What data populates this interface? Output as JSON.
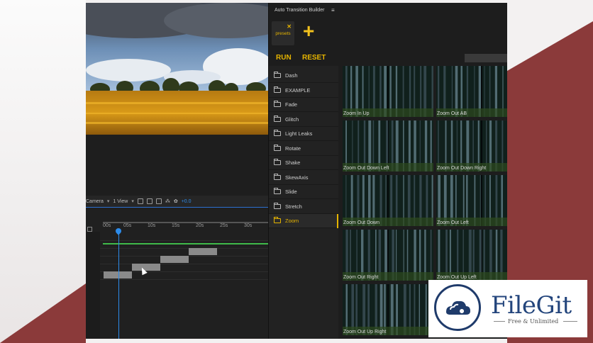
{
  "colors": {
    "accent": "#e6b400",
    "timeline_blue": "#2d8ceb",
    "layer_green": "#3fba4a",
    "brand_bg": "#8b3a3a",
    "logo_blue": "#23457c"
  },
  "viewer_toolbar": {
    "camera_label": "Camera",
    "view_label": "1 View",
    "exposure_value": "+0.0"
  },
  "timeline": {
    "ruler_labels": [
      "00s",
      "05s",
      "10s",
      "15s",
      "20s",
      "25s",
      "30s"
    ]
  },
  "panel": {
    "title": "Auto Transition Builder",
    "menu_icon": "hamburger-icon",
    "presets_tab_label": "presets",
    "add_icon": "plus-icon",
    "run_label": "RUN",
    "reset_label": "RESET",
    "folders": [
      {
        "label": "Dash"
      },
      {
        "label": "EXAMPLE"
      },
      {
        "label": "Fade"
      },
      {
        "label": "Glitch"
      },
      {
        "label": "Light Leaks"
      },
      {
        "label": "Rotate"
      },
      {
        "label": "Shake"
      },
      {
        "label": "SkewAxis"
      },
      {
        "label": "Slide"
      },
      {
        "label": "Stretch"
      },
      {
        "label": "Zoom"
      }
    ],
    "active_folder": "Zoom",
    "presets": [
      {
        "label": "Zoom In Up"
      },
      {
        "label": "Zoom Out AB"
      },
      {
        "label": "Zoom Out Down Left"
      },
      {
        "label": "Zoom Out Down Right"
      },
      {
        "label": "Zoom Out Down"
      },
      {
        "label": "Zoom Out Left"
      },
      {
        "label": "Zoom Out Right"
      },
      {
        "label": "Zoom Out Up Left"
      },
      {
        "label": "Zoom Out Up Right"
      }
    ]
  },
  "watermark": {
    "name": "FileGit",
    "tagline": "Free & Unlimited"
  }
}
